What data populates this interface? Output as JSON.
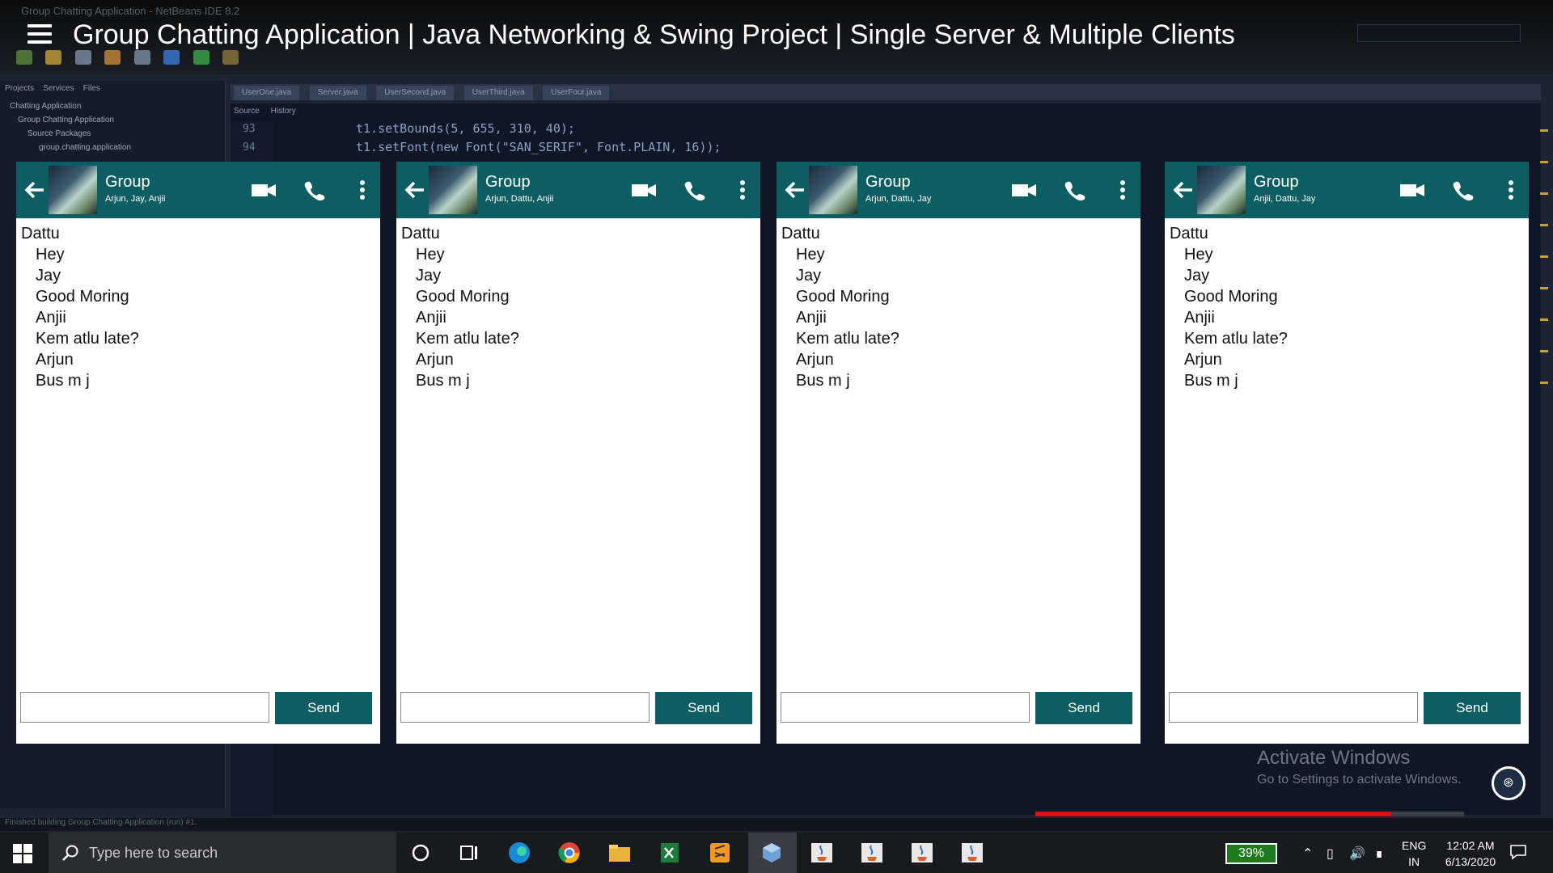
{
  "video": {
    "title": "Group Chatting Application | Java Networking & Swing Project | Single Server & Multiple Clients",
    "ide_window_title": "Group Chatting Application - NetBeans IDE 8.2"
  },
  "ide": {
    "project_tabs": [
      "Projects",
      "Services",
      "Files"
    ],
    "tree": [
      "Chatting Application",
      "Group Chatting Application",
      "Source Packages",
      "group.chatting.application"
    ],
    "editor_tabs": [
      "UserOne.java",
      "Server.java",
      "UserSecond.java",
      "UserThird.java",
      "UserFour.java"
    ],
    "editor_subtabs": [
      "Source",
      "History"
    ],
    "line_numbers": [
      "93",
      "94"
    ],
    "code_lines": [
      "t1.setBounds(5, 655, 310, 40);",
      "t1.setFont(new Font(\"SAN_SERIF\", Font.PLAIN, 16));"
    ],
    "status_text": "Finished building Group Chatting Application (run) #1.",
    "activate_title": "Activate Windows",
    "activate_sub": "Go to Settings to activate Windows."
  },
  "chats": [
    {
      "title": "Group",
      "members": "Arjun, Jay, Anjii",
      "sender": "Dattu",
      "messages": [
        "Hey",
        "Jay",
        "Good Moring",
        "Anjii",
        "Kem atlu late?",
        "Arjun",
        "Bus m j"
      ],
      "send_label": "Send"
    },
    {
      "title": "Group",
      "members": "Arjun, Dattu, Anjii",
      "sender": "Dattu",
      "messages": [
        "Hey",
        "Jay",
        "Good Moring",
        "Anjii",
        "Kem atlu late?",
        "Arjun",
        "Bus m j"
      ],
      "send_label": "Send"
    },
    {
      "title": "Group",
      "members": "Arjun, Dattu, Jay",
      "sender": "Dattu",
      "messages": [
        "Hey",
        "Jay",
        "Good Moring",
        "Anjii",
        "Kem atlu late?",
        "Arjun",
        "Bus m j"
      ],
      "send_label": "Send"
    },
    {
      "title": "Group",
      "members": "Anjii, Dattu, Jay",
      "sender": "Dattu",
      "messages": [
        "Hey",
        "Jay",
        "Good Moring",
        "Anjii",
        "Kem atlu late?",
        "Arjun",
        "Bus m j"
      ],
      "send_label": "Send"
    }
  ],
  "colors": {
    "header": "#0d5e62",
    "send_button": "#0d5e62"
  },
  "video_progress": 0.83,
  "taskbar": {
    "search_placeholder": "Type here to search",
    "apps": [
      "cortana-icon",
      "task-view-icon",
      "edge-icon",
      "chrome-icon",
      "file-explorer-icon",
      "excel-icon",
      "sublime-icon",
      "virtualbox-icon",
      "java-icon",
      "java-icon",
      "java-icon",
      "java-icon"
    ],
    "battery": "39%",
    "lang_line1": "ENG",
    "lang_line2": "IN",
    "time": "12:02 AM",
    "date": "6/13/2020"
  }
}
